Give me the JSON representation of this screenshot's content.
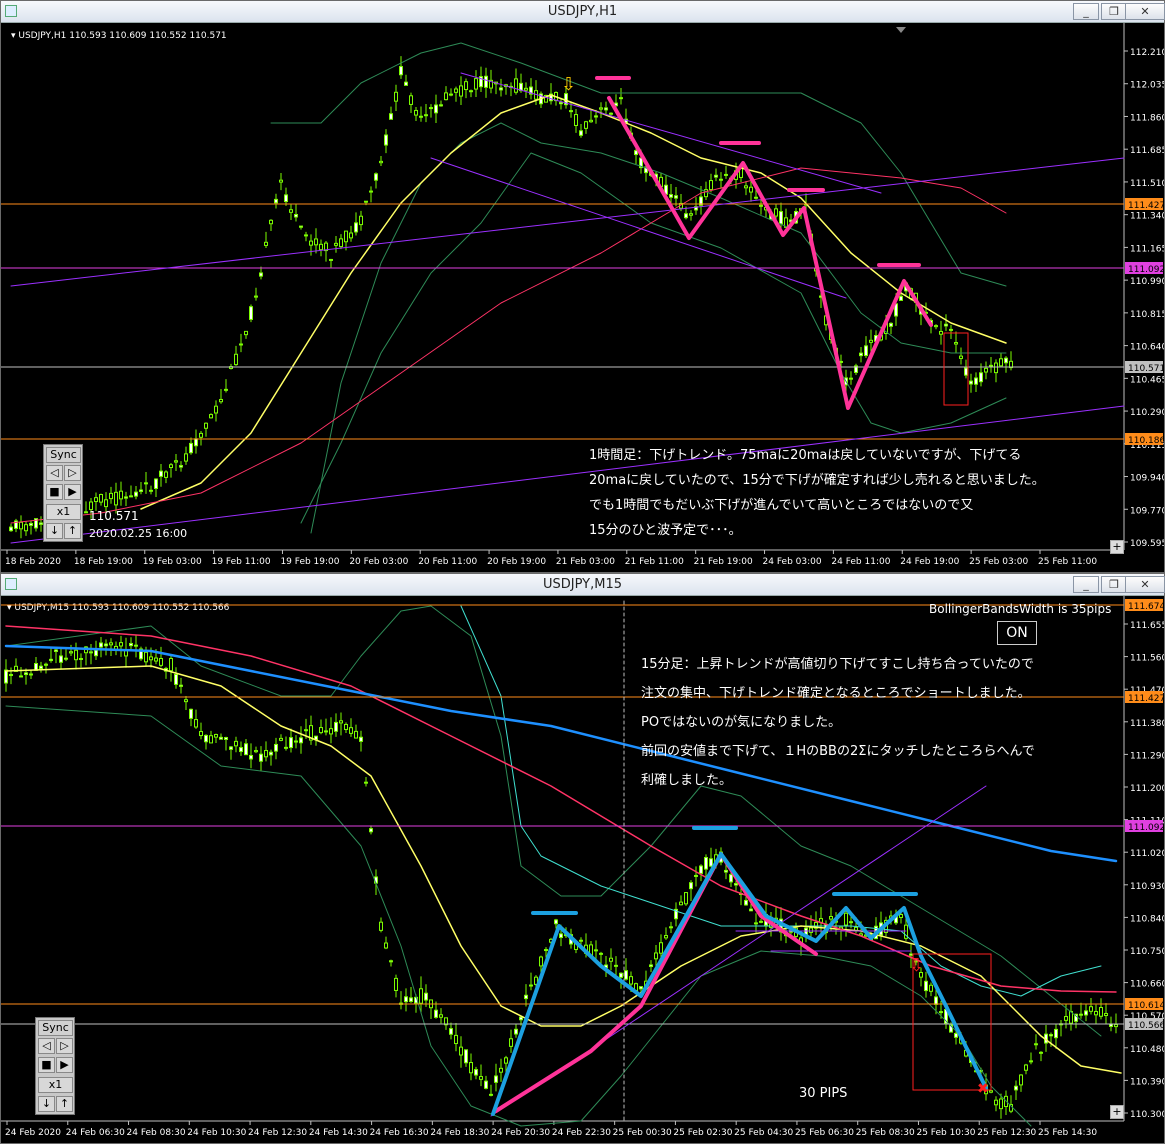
{
  "h1": {
    "title": "USDJPY,H1",
    "header": "USDJPY,H1  110.593 110.609 110.552 110.571",
    "price_labels": [
      "112.210",
      "112.035",
      "111.860",
      "111.685",
      "111.510",
      "111.340",
      "111.165",
      "110.990",
      "110.815",
      "110.640",
      "110.465",
      "110.290",
      "110.115",
      "109.940",
      "109.770",
      "109.595"
    ],
    "hlines": [
      {
        "label": "111.427",
        "color": "#ff8c1a"
      },
      {
        "label": "111.092",
        "color": "#e040e0"
      },
      {
        "label": "110.571",
        "color": "#c0c0c0"
      },
      {
        "label": "110.186",
        "color": "#ff8c1a"
      }
    ],
    "time_labels": [
      "18 Feb 2020",
      "18 Feb 19:00",
      "19 Feb 03:00",
      "19 Feb 11:00",
      "19 Feb 19:00",
      "20 Feb 03:00",
      "20 Feb 11:00",
      "20 Feb 19:00",
      "21 Feb 03:00",
      "21 Feb 11:00",
      "21 Feb 19:00",
      "24 Feb 03:00",
      "24 Feb 11:00",
      "24 Feb 19:00",
      "25 Feb 03:00",
      "25 Feb 11:00"
    ],
    "sync": {
      "label": "Sync",
      "speed": "x1",
      "price": "110.571",
      "datetime": "2020.02.25 16:00"
    },
    "notes": [
      "1時間足：下げトレンド。75maに20maは戻していないですが、下げてる",
      "20maに戻していたので、15分で下げが確定すれば少し売れると思いました。",
      "でも1時間でもだいぶ下げが進んでいて高いところではないので又",
      "15分のひと波予定で･･･。"
    ]
  },
  "m15": {
    "title": "USDJPY,M15",
    "header": "USDJPY,M15  110.593 110.609 110.552 110.566",
    "bbw": "BollingerBandsWidth is 35pips",
    "on_label": "ON",
    "price_labels": [
      "111.655",
      "111.560",
      "111.470",
      "111.380",
      "111.290",
      "111.200",
      "111.110",
      "111.020",
      "110.930",
      "110.840",
      "110.750",
      "110.660",
      "110.570",
      "110.480",
      "110.390",
      "110.300"
    ],
    "hlines": [
      {
        "label": "111.674",
        "color": "#ff8c1a"
      },
      {
        "label": "111.427",
        "color": "#ff8c1a"
      },
      {
        "label": "111.092",
        "color": "#e040e0"
      },
      {
        "label": "110.614",
        "color": "#ff8c1a"
      },
      {
        "label": "110.566",
        "color": "#c0c0c0"
      }
    ],
    "time_labels": [
      "24 Feb 2020",
      "24 Feb 06:30",
      "24 Feb 08:30",
      "24 Feb 10:30",
      "24 Feb 12:30",
      "24 Feb 14:30",
      "24 Feb 16:30",
      "24 Feb 18:30",
      "24 Feb 20:30",
      "24 Feb 22:30",
      "25 Feb 00:30",
      "25 Feb 02:30",
      "25 Feb 04:30",
      "25 Feb 06:30",
      "25 Feb 08:30",
      "25 Feb 10:30",
      "25 Feb 12:30",
      "25 Feb 14:30"
    ],
    "sync": {
      "label": "Sync",
      "speed": "x1"
    },
    "pips_label": "30 PIPS",
    "notes": [
      "15分足：上昇トレンドが高値切り下げてすこし持ち合っていたので",
      "注文の集中、下げトレンド確定となるところでショートしました。",
      "POではないのが気になりました。",
      "前回の安値まで下げて、１HのBBの2Σにタッチしたところらへんで",
      "利確しました。"
    ]
  }
}
